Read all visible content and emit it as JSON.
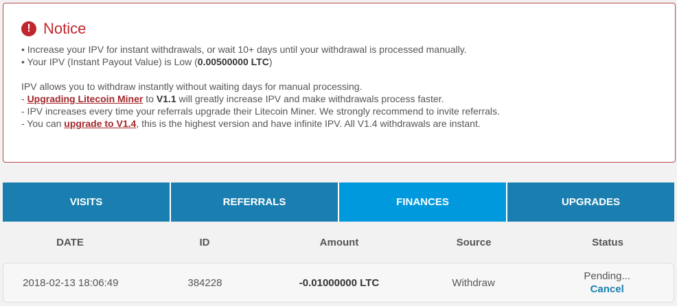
{
  "notice": {
    "icon": "exclamation-icon",
    "title": "Notice",
    "line1": "• Increase your IPV for instant withdrawals, or wait 10+ days until your withdrawal is processed manually.",
    "line2_prefix": "• Your IPV (Instant Payout Value) is Low (",
    "line2_value": "0.00500000 LTC",
    "line2_suffix": ")",
    "line3": "IPV allows you to withdraw instantly without waiting days for manual processing.",
    "line4_prefix": "- ",
    "line4_link": "Upgrading Litecoin Miner",
    "line4_mid": " to ",
    "line4_version": "V1.1",
    "line4_suffix": " will greatly increase IPV and make withdrawals process faster.",
    "line5": "- IPV increases every time your referrals upgrade their Litecoin Miner. We strongly recommend to invite referrals.",
    "line6_prefix": "- You can ",
    "line6_link": "upgrade to V1.4",
    "line6_suffix": ", this is the highest version and have infinite IPV. All V1.4 withdrawals are instant."
  },
  "tabs": [
    {
      "label": "VISITS",
      "active": false
    },
    {
      "label": "REFERRALS",
      "active": false
    },
    {
      "label": "FINANCES",
      "active": true
    },
    {
      "label": "UPGRADES",
      "active": false
    }
  ],
  "table": {
    "headers": [
      "DATE",
      "ID",
      "Amount",
      "Source",
      "Status"
    ],
    "rows": [
      {
        "date": "2018-02-13 18:06:49",
        "id": "384228",
        "amount": "-0.01000000 LTC",
        "source": "Withdraw",
        "status": "Pending...",
        "action": "Cancel"
      }
    ]
  },
  "colors": {
    "notice_red": "#c0262d",
    "tab_blue": "#1a7fb0",
    "tab_active_blue": "#0099dd"
  }
}
